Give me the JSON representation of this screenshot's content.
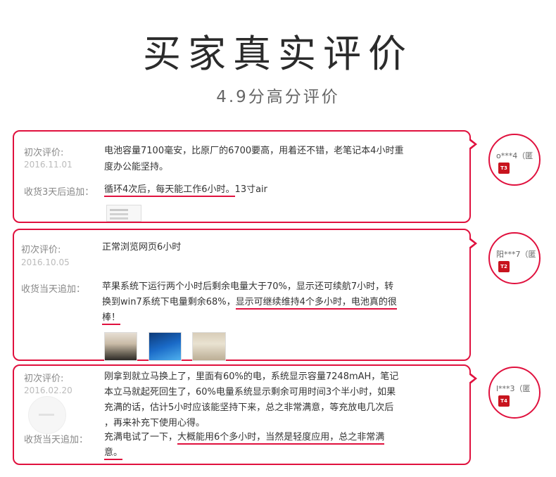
{
  "header": {
    "title": "买家真实评价",
    "subtitle": "4.9分高分评价"
  },
  "colors": {
    "accent": "#e0113e",
    "badge": "#c8141e"
  },
  "reviews": [
    {
      "first_label": "初次评价:",
      "first_date": "2016.11.01",
      "first_text_lines": [
        "电池容量7100毫安，比原厂的6700要高，用着还不错，老笔记本4小时重",
        "度办公能坚持。"
      ],
      "append_label": "收货3天后追加：",
      "append_underlined": "循环4次后，每天能工作6小时。",
      "append_rest": "13寸air",
      "user": "o***4（匿",
      "level": "T3",
      "images": [
        "document-thumbnail"
      ]
    },
    {
      "first_label": "初次评价:",
      "first_date": "2016.10.05",
      "first_text": "正常浏览网页6小时",
      "append_label": "收货当天追加：",
      "append_line1": "苹果系统下运行两个小时后剩余电量大于70%，显示还可续航7小时，转",
      "append_line2_plain": "换到win7系统下电量剩余68%，",
      "append_line2_underlined": "显示可继续维持4个多小时，电池真的很",
      "append_line3_underlined": "棒！",
      "user": "阳***7（匿",
      "level": "T2",
      "images": [
        "laptop-photo",
        "windows7-screen-photo",
        "battery-photo"
      ]
    },
    {
      "first_label": "初次评价:",
      "first_date": "2016.02.20",
      "first_text_lines": [
        "刚拿到就立马换上了，里面有60%的电，系统显示容量7248mAH，笔记",
        "本立马就起死回生了，60%电量系统显示剩余可用时间3个半小时，如果",
        "充满的话，估计5小时应该能坚持下来，总之非常满意，等充放电几次后",
        "，再来补充下使用心得。"
      ],
      "append_label": "收货当天追加：",
      "append_line1_plain": "充满电试了一下，",
      "append_line1_underlined": "大概能用6个多小时，当然是轻度应用，总之非常满",
      "append_line2_underlined": "意。",
      "user": "l***3（匿",
      "level": "T4"
    }
  ]
}
